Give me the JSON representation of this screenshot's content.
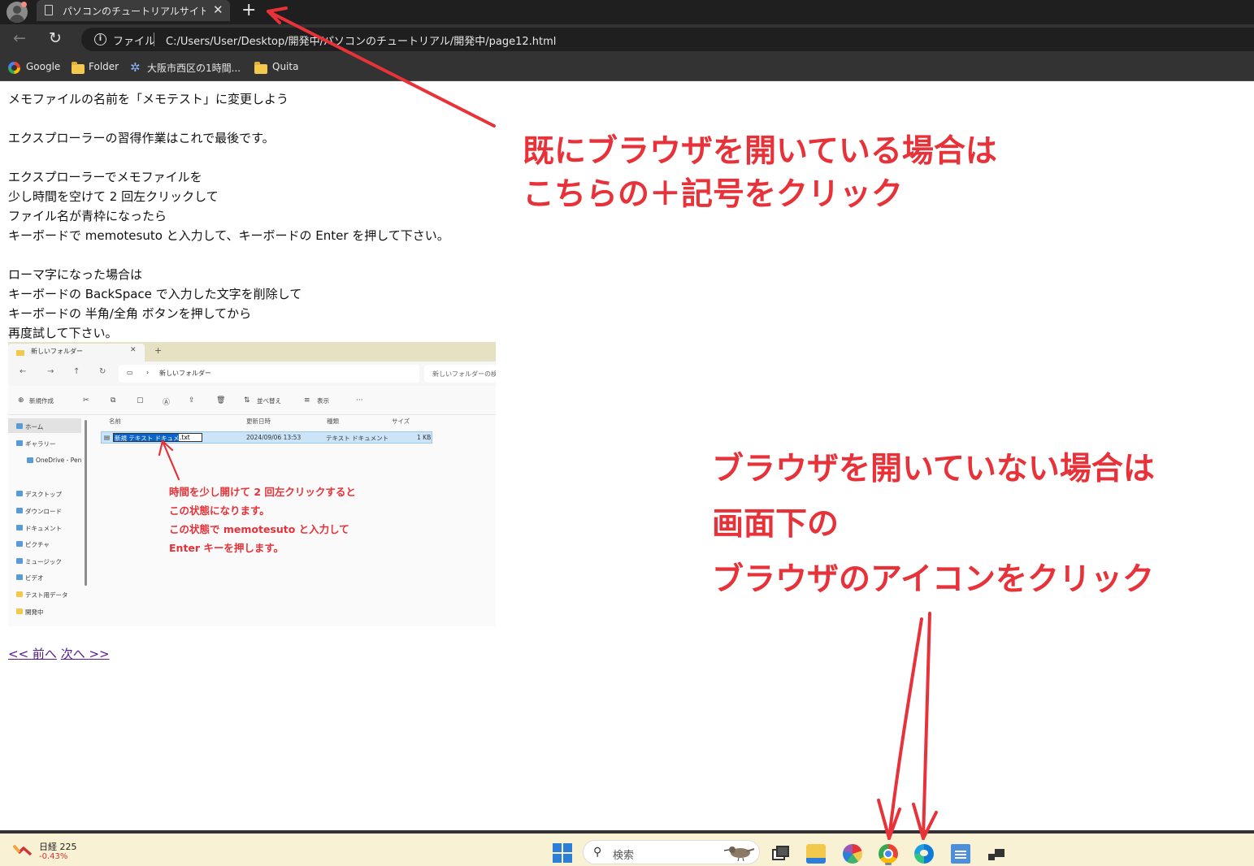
{
  "browser": {
    "tab_title": "パソコンのチュートリアルサイト | Gifted",
    "new_tab_label": "+",
    "address_scheme": "ファイル",
    "address_url": "C:/Users/User/Desktop/開発中/パソコンのチュートリアル/開発中/page12.html",
    "bookmarks": [
      "Google",
      "Folder",
      "大阪市西区の1時間...",
      "Quita"
    ]
  },
  "page": {
    "lines_a": [
      "メモファイルの名前を「メモテスト」に変更しよう"
    ],
    "lines_b": [
      "エクスプローラーの習得作業はこれで最後です。"
    ],
    "lines_c": [
      "エクスプローラーでメモファイルを",
      "少し時間を空けて 2 回左クリックして",
      "ファイル名が青枠になったら",
      "キーボードで memotesuto と入力して、キーボードの Enter を押して下さい。"
    ],
    "lines_d": [
      "ローマ字になった場合は",
      "キーボードの BackSpace で入力した文字を削除して",
      "キーボードの 半角/全角 ボタンを押してから",
      "再度試して下さい。"
    ],
    "prev_link": "<< 前へ",
    "next_link": "次へ >>"
  },
  "explorer_shot": {
    "tab_title": "新しいフォルダー",
    "address_path": "新しいフォルダー",
    "search_placeholder": "新しいフォルダーの検",
    "toolbar": {
      "new": "新規作成",
      "sort": "並べ替え",
      "view": "表示",
      "more": "···"
    },
    "sidebar": [
      "ホーム",
      "ギャラリー",
      "OneDrive - Pen",
      "デスクトップ",
      "ダウンロード",
      "ドキュメント",
      "ピクチャ",
      "ミュージック",
      "ビデオ",
      "テスト用データ",
      "開発中"
    ],
    "columns": [
      "名前",
      "更新日時",
      "種類",
      "サイズ"
    ],
    "row": {
      "name_selected": "新規 テキスト ドキュメント",
      "name_rest": ".txt",
      "date": "2024/09/06 13:53",
      "type": "テキスト ドキュメント",
      "size": "1 KB"
    },
    "note_lines": [
      "時間を少し開けて 2 回左クリックすると",
      "この状態になります。",
      "この状態で memotesuto と入力して",
      "Enter キーを押します。"
    ]
  },
  "annotations": {
    "top": [
      "既にブラウザを開いている場合は",
      "こちらの＋記号をクリック"
    ],
    "bottom": [
      "ブラウザを開いていない場合は",
      "画面下の",
      "ブラウザのアイコンをクリック"
    ],
    "color": "#e8323a"
  },
  "taskbar": {
    "stock_name": "日経 225",
    "stock_change": "-0.43%",
    "search_label": "検索",
    "icons": [
      "start-icon",
      "search-icon",
      "task-view-icon",
      "file-explorer-icon",
      "paint-icon",
      "chrome-icon",
      "edge-icon",
      "notepad-icon",
      "app-icon"
    ]
  }
}
